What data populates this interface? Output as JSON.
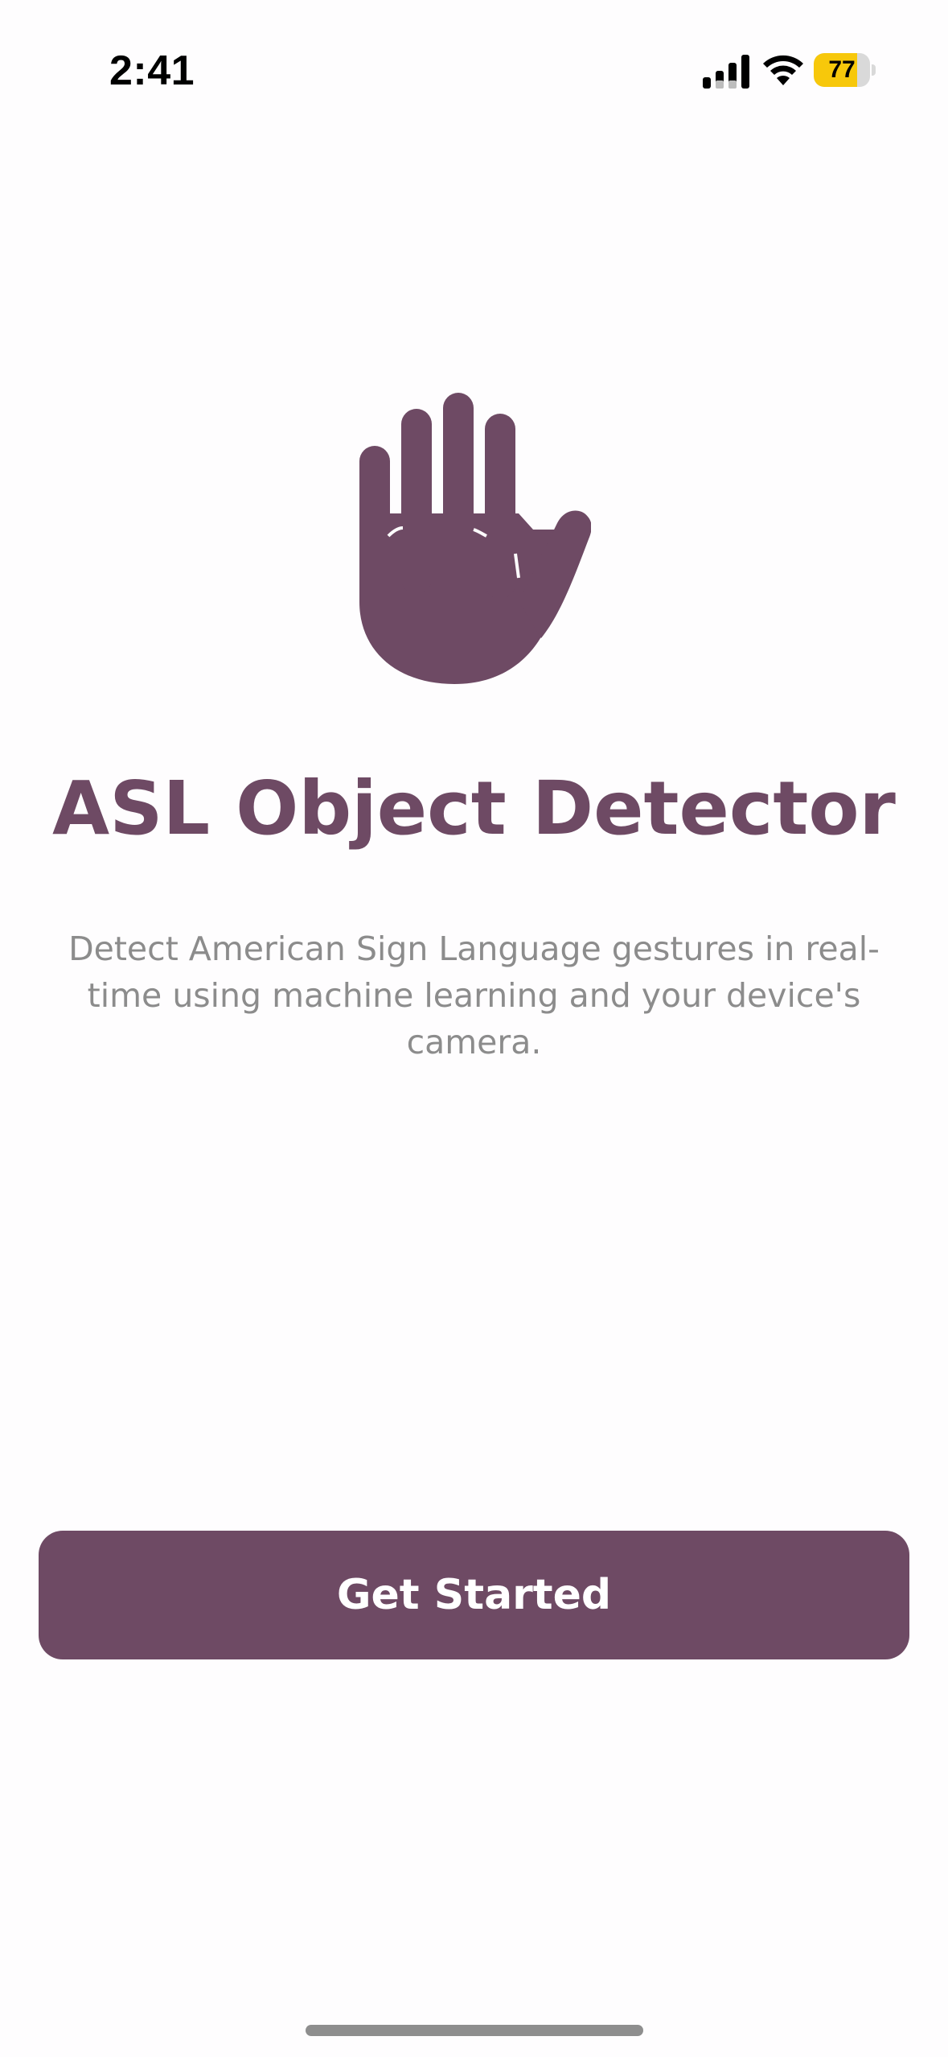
{
  "status_bar": {
    "time": "2:41",
    "battery_level": "77",
    "battery_fraction": 0.77,
    "battery_color": "#f7c80b",
    "signal_icon": "cellular-signal-icon",
    "wifi_icon": "wifi-icon"
  },
  "hero": {
    "icon": "raised-hand-icon",
    "title": "ASL Object Detector",
    "description": "Detect American Sign Language gestures in real-time using machine learning and your device's camera."
  },
  "actions": {
    "primary_label": "Get Started"
  },
  "colors": {
    "accent": "#6e4a64",
    "description_text": "#8c8c8c",
    "background": "#fefdfe"
  }
}
